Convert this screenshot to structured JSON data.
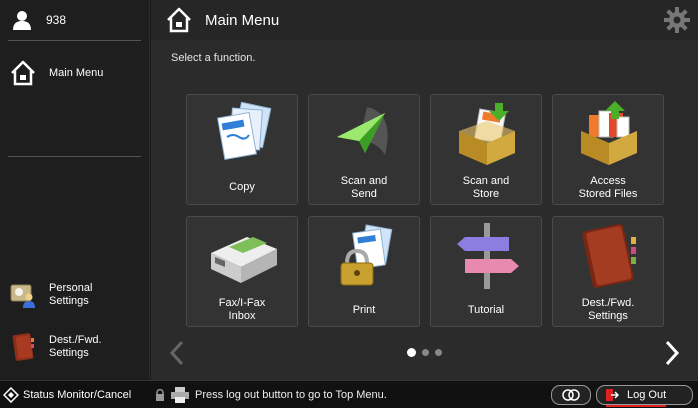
{
  "user": {
    "name": "938"
  },
  "sidebar": {
    "main_menu": "Main Menu",
    "personal_settings": "Personal\nSettings",
    "dest_settings": "Dest./Fwd.\nSettings"
  },
  "header": {
    "title": "Main Menu"
  },
  "main": {
    "hint": "Select a function.",
    "tiles": [
      {
        "label": "Copy"
      },
      {
        "label": "Scan and\nSend"
      },
      {
        "label": "Scan and\nStore"
      },
      {
        "label": "Access\nStored Files"
      },
      {
        "label": "Fax/I-Fax\nInbox"
      },
      {
        "label": "Print"
      },
      {
        "label": "Tutorial"
      },
      {
        "label": "Dest./Fwd.\nSettings"
      }
    ],
    "page_indicator": {
      "current": 1,
      "total": 3
    }
  },
  "footer": {
    "status_monitor": "Status Monitor/Cancel",
    "message": "Press log out button to go to Top Menu.",
    "logout": "Log Out"
  },
  "icons": [
    "user-icon",
    "home-icon",
    "gear-icon",
    "copy-icon",
    "scan-send-icon",
    "scan-store-icon",
    "stored-files-icon",
    "fax-inbox-icon",
    "print-icon",
    "tutorial-icon",
    "address-book-icon",
    "personal-settings-icon",
    "chevron-left-icon",
    "chevron-right-icon",
    "status-monitor-icon",
    "lock-icon",
    "printer-icon",
    "switch-icon",
    "logout-icon"
  ],
  "colors": {
    "logout_underline": "#e02020",
    "accent_green": "#4caf2a"
  }
}
